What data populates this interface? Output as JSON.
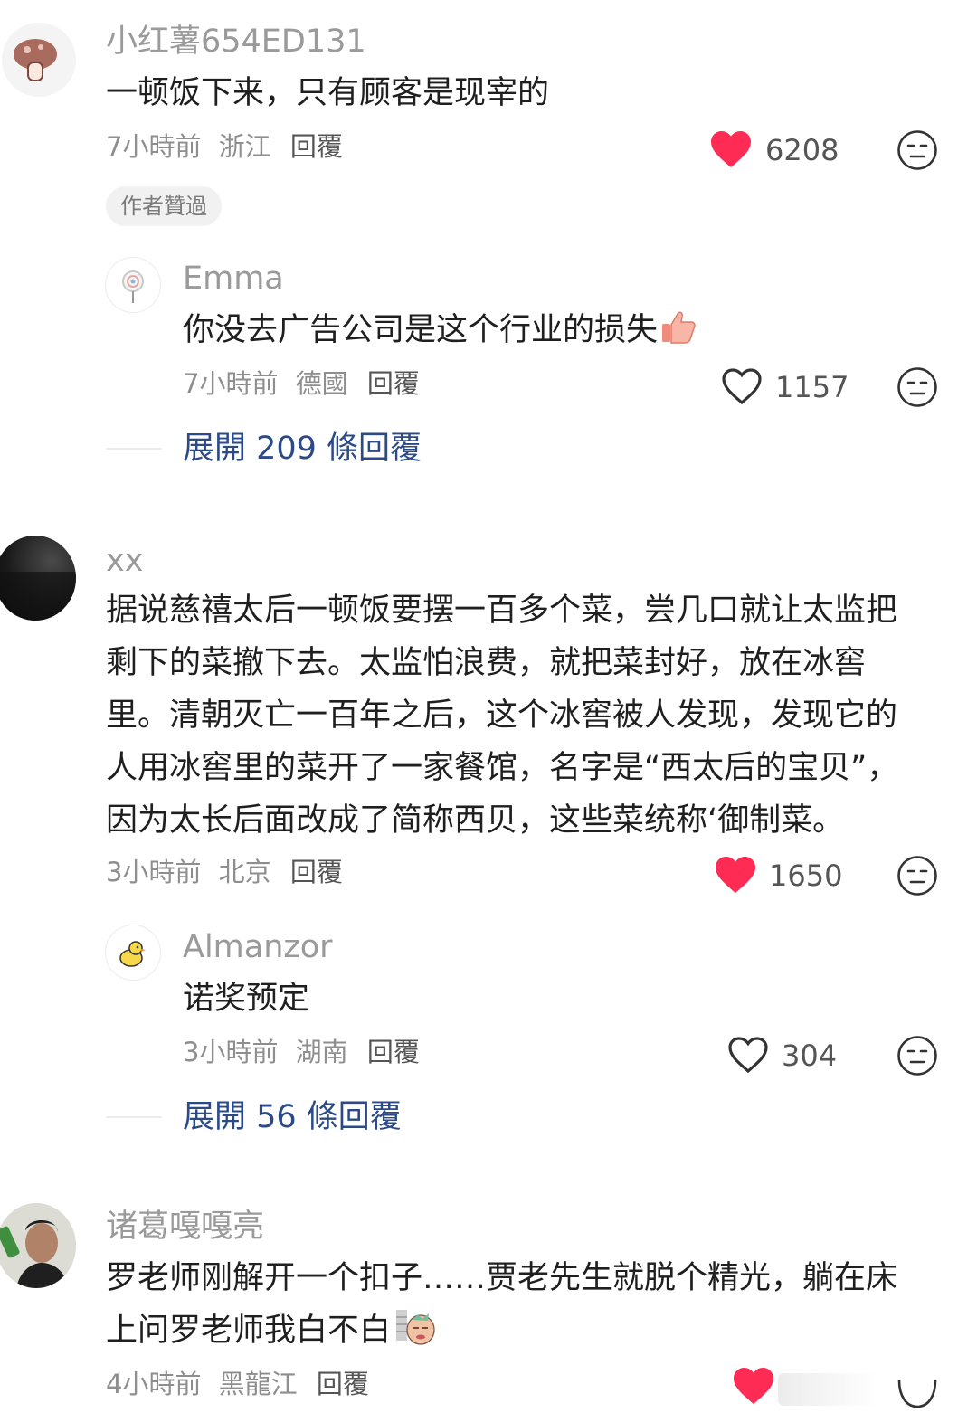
{
  "comments": [
    {
      "author": "小红薯654ED131",
      "text": "一顿饭下来，只有顾客是现宰的",
      "time": "7小時前",
      "location": "浙江",
      "reply_label": "回覆",
      "likes": "6208",
      "liked": true,
      "badge": "作者贊過",
      "replies": [
        {
          "author": "Emma",
          "text": "你没去广告公司是这个行业的损失",
          "time": "7小時前",
          "location": "德國",
          "reply_label": "回覆",
          "likes": "1157",
          "liked": false
        }
      ],
      "expand_label": "展開 209 條回覆"
    },
    {
      "author": "xx",
      "text_lines": [
        "据说慈禧太后一顿饭要摆一百多个菜，尝几口就让太监把",
        "剩下的菜撤下去。太监怕浪费，就把菜封好，放在冰窖",
        "里。清朝灭亡一百年之后，这个冰窖被人发现，发现它的",
        "人用冰窖里的菜开了一家餐馆，名字是“西太后的宝贝”，",
        "因为太长后面改成了简称西贝，这些菜统称‘御制菜。"
      ],
      "time": "3小時前",
      "location": "北京",
      "reply_label": "回覆",
      "likes": "1650",
      "liked": true,
      "replies": [
        {
          "author": "Almanzor",
          "text": "诺奖预定",
          "time": "3小時前",
          "location": "湖南",
          "reply_label": "回覆",
          "likes": "304",
          "liked": false
        }
      ],
      "expand_label": "展開 56 條回覆"
    },
    {
      "author": "诸葛嘎嘎亮",
      "text_lines": [
        "罗老师刚解开一个扣子……贾老先生就脱个精光，躺在床",
        "上问罗老师我白不白"
      ],
      "time": "4小時前",
      "location": "黑龍江",
      "reply_label": "回覆",
      "liked": true
    }
  ],
  "colors": {
    "heart_liked": "#fe2c55",
    "expand_link": "#2b4a86",
    "name": "#9a9a9a"
  },
  "icons": {
    "like": "heart-icon",
    "dislike": "meh-face-icon",
    "emoji_thumbs": "thumbs-up-emoji",
    "emoji_sticker": "face-sticker-emoji"
  }
}
